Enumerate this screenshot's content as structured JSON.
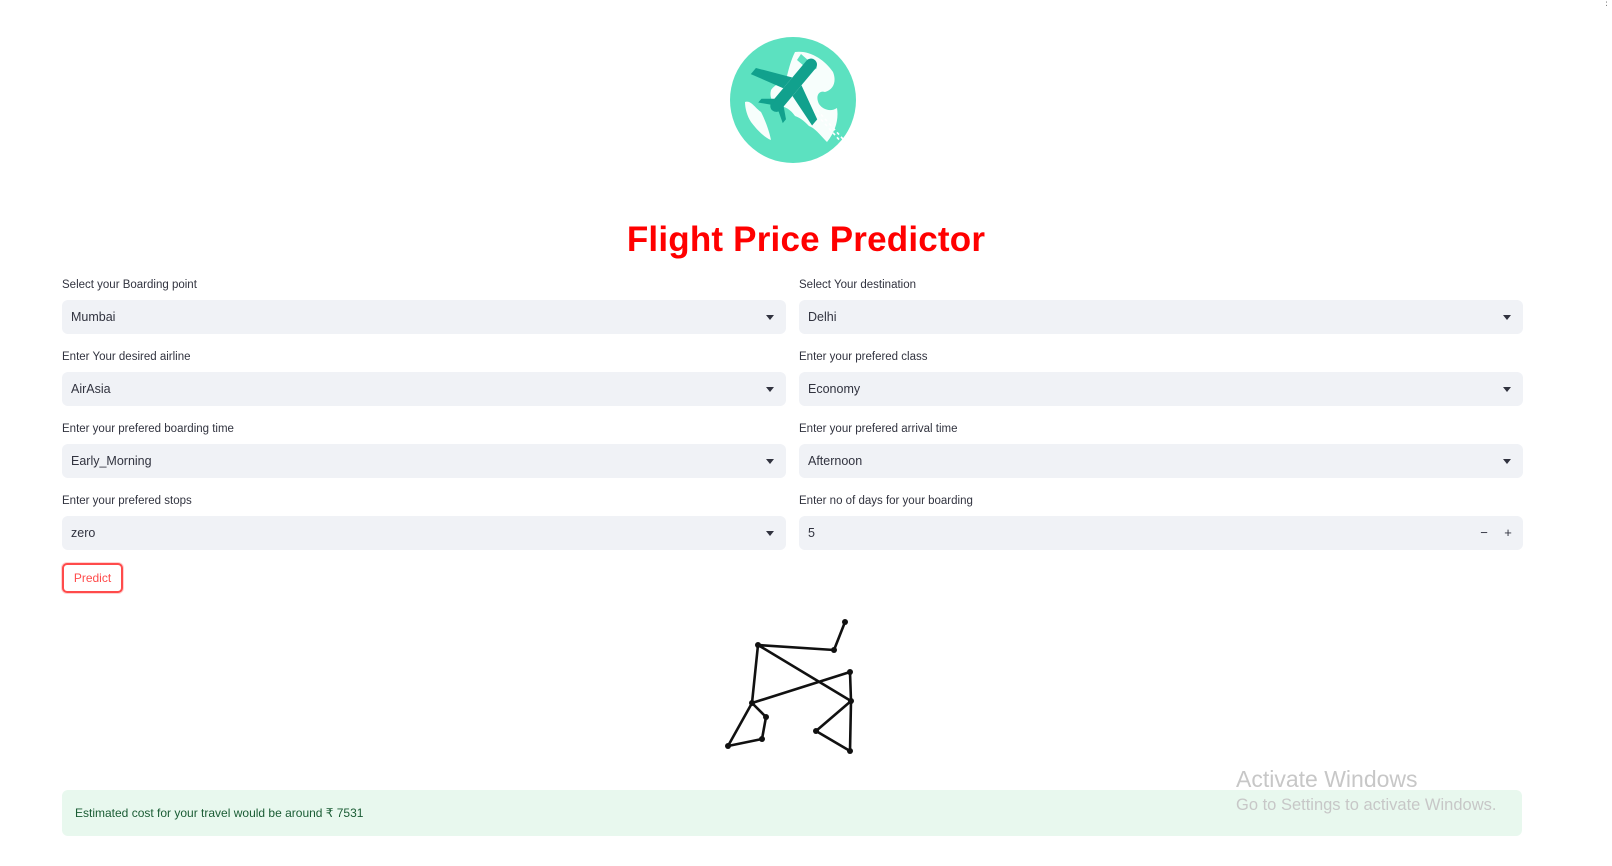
{
  "app": {
    "title": "Flight Price Predictor",
    "colors": {
      "title": "#ff0000",
      "accent": "#ff4b4b",
      "globe": "#5ce1c0",
      "plane": "#11a18d",
      "success_bg": "#e8f8ee"
    }
  },
  "logo": {
    "icon": "globe-plane-icon"
  },
  "form": {
    "boarding": {
      "label": "Select your Boarding point",
      "value": "Mumbai"
    },
    "destination": {
      "label": "Select Your destination",
      "value": "Delhi"
    },
    "airline": {
      "label": "Enter Your desired airline",
      "value": "AirAsia"
    },
    "class": {
      "label": "Enter your prefered class",
      "value": "Economy"
    },
    "boarding_time": {
      "label": "Enter your prefered boarding time",
      "value": "Early_Morning"
    },
    "arrival_time": {
      "label": "Enter your prefered arrival time",
      "value": "Afternoon"
    },
    "stops": {
      "label": "Enter your prefered stops",
      "value": "zero"
    },
    "days": {
      "label": "Enter no of days for your boarding",
      "value": "5",
      "minus": "−",
      "plus": "+"
    }
  },
  "predict_button": {
    "label": "Predict"
  },
  "graph": {
    "icon": "network-graph-icon"
  },
  "result": {
    "text": "Estimated cost for your travel would be around ₹ 7531"
  },
  "watermark": {
    "line1": "Activate Windows",
    "line2": "Go to Settings to activate Windows."
  }
}
